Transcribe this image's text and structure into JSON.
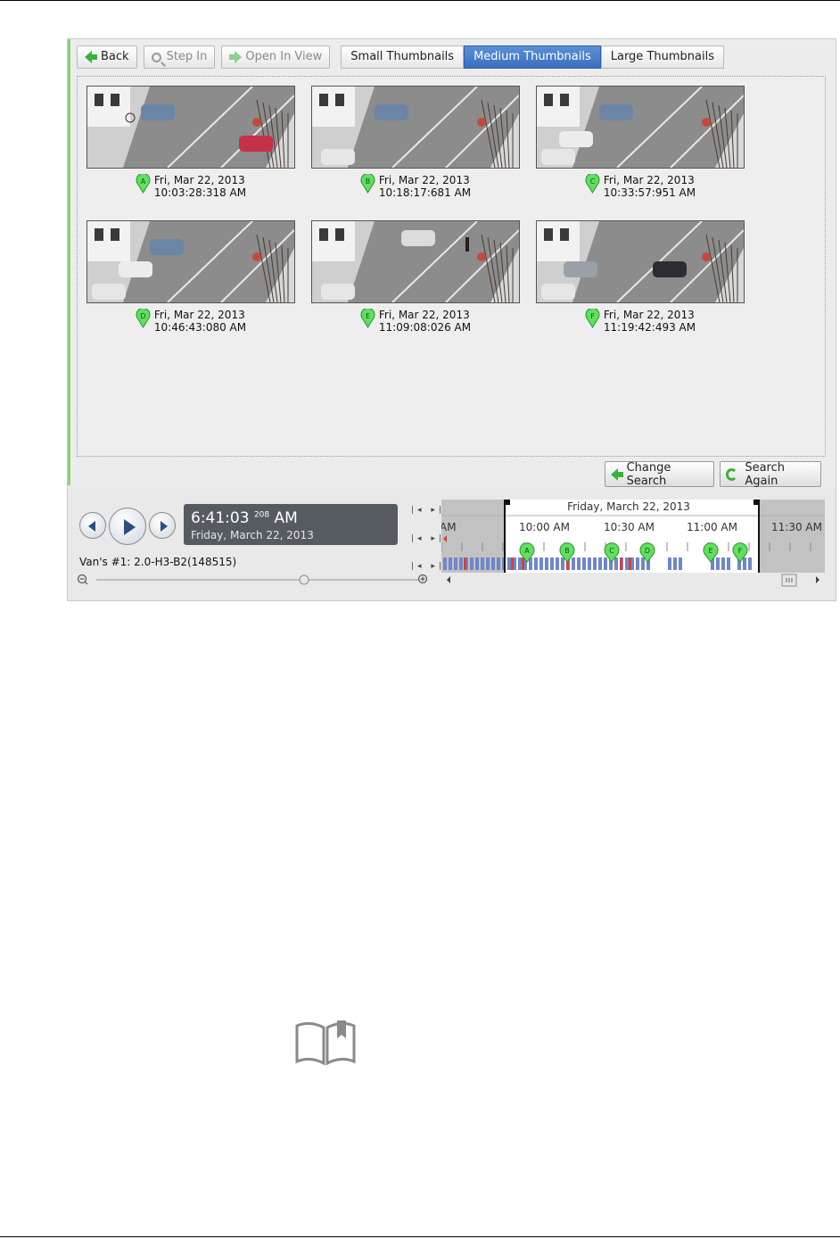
{
  "toolbar": {
    "back": "Back",
    "step_in": "Step In",
    "open_in_view": "Open In View",
    "views": [
      "Small Thumbnails",
      "Medium Thumbnails",
      "Large Thumbnails"
    ],
    "active_view": "Medium Thumbnails"
  },
  "results": [
    {
      "marker": "A",
      "date": "Fri, Mar 22, 2013",
      "time": "10:03:28:318 AM"
    },
    {
      "marker": "B",
      "date": "Fri, Mar 22, 2013",
      "time": "10:18:17:681 AM"
    },
    {
      "marker": "C",
      "date": "Fri, Mar 22, 2013",
      "time": "10:33:57:951 AM"
    },
    {
      "marker": "D",
      "date": "Fri, Mar 22, 2013",
      "time": "10:46:43:080 AM"
    },
    {
      "marker": "E",
      "date": "Fri, Mar 22, 2013",
      "time": "11:09:08:026 AM"
    },
    {
      "marker": "F",
      "date": "Fri, Mar 22, 2013",
      "time": "11:19:42:493 AM"
    }
  ],
  "actions": {
    "change_search": "Change Search",
    "search_again": "Search Again"
  },
  "player": {
    "time": "6:41:03",
    "ms": "208",
    "ampm": "AM",
    "date": "Friday, March 22, 2013",
    "camera": "Van's #1: 2.0-H3-B2(148515)"
  },
  "timeline": {
    "date_label": "Friday, March 22, 2013",
    "ticks": [
      "AM",
      "10:00 AM",
      "10:30 AM",
      "11:00 AM",
      "11:30 AM"
    ],
    "markers": [
      "A",
      "B",
      "C",
      "D",
      "E",
      "F"
    ]
  },
  "colors": {
    "accent": "#3a6fc0",
    "marker": "#5fe05f",
    "motion": "#6f86c9",
    "event": "#d64040"
  }
}
